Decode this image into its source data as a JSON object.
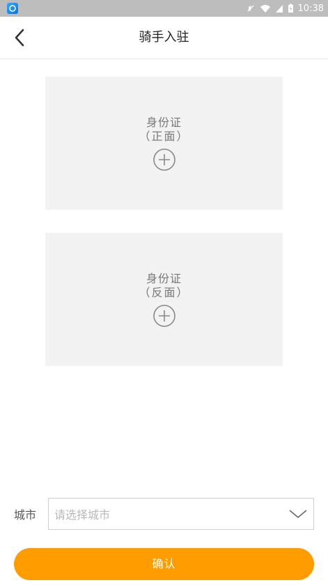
{
  "status_bar": {
    "time": "10:38",
    "icons": [
      "app-icon",
      "mute-icon",
      "wifi-icon",
      "signal-icon",
      "battery-icon"
    ]
  },
  "header": {
    "title": "骑手入驻",
    "back_icon": "chevron-left-icon"
  },
  "id_front": {
    "label": "身份证",
    "sub_label": "（正面）",
    "icon": "plus-circle-icon"
  },
  "id_back": {
    "label": "身份证",
    "sub_label": "（反面）",
    "icon": "plus-circle-icon"
  },
  "city": {
    "label": "城市",
    "placeholder": "请选择城市",
    "dropdown_icon": "chevron-down-icon"
  },
  "confirm": {
    "label": "确认"
  },
  "colors": {
    "accent": "#ff9c00",
    "status_bar": "#bdbdbd",
    "card_bg": "#f2f2f2"
  }
}
